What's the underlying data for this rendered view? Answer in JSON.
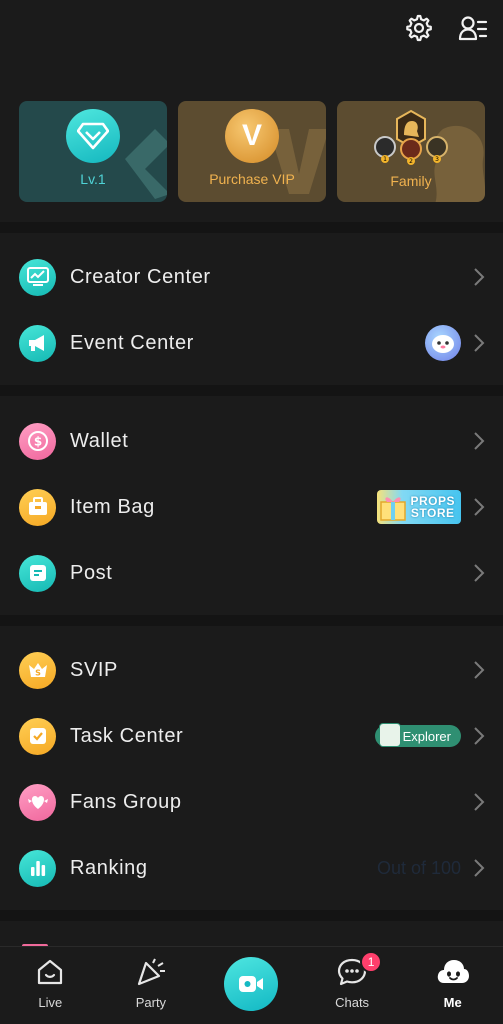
{
  "header": {
    "icons": [
      "gear-icon",
      "contacts-menu-icon"
    ]
  },
  "cards": [
    {
      "label": "Lv.1",
      "icon": "diamond-icon"
    },
    {
      "label": "Purchase VIP",
      "badge_letter": "V"
    },
    {
      "label": "Family",
      "icon": "family-crest-icon",
      "medals": [
        "1",
        "2",
        "3"
      ]
    }
  ],
  "sections": {
    "s1": [
      {
        "label": "Creator Center",
        "icon": "chart-board-icon"
      },
      {
        "label": "Event Center",
        "icon": "megaphone-icon",
        "extra": "event-avatar"
      }
    ],
    "s2": [
      {
        "label": "Wallet",
        "icon": "coin-icon"
      },
      {
        "label": "Item Bag",
        "icon": "bag-icon",
        "extra_lines": [
          "PROPS",
          "STORE"
        ]
      },
      {
        "label": "Post",
        "icon": "post-icon"
      }
    ],
    "s3": [
      {
        "label": "SVIP",
        "icon": "crown-coin-icon"
      },
      {
        "label": "Task Center",
        "icon": "task-icon",
        "tag": "Explorer"
      },
      {
        "label": "Fans Group",
        "icon": "heart-wings-icon"
      },
      {
        "label": "Ranking",
        "icon": "bar-chart-icon",
        "extra": "Out of 100"
      }
    ]
  },
  "bottom_nav": [
    {
      "label": "Live",
      "icon": "home-face-icon"
    },
    {
      "label": "Party",
      "icon": "party-popper-icon"
    },
    {
      "label": "",
      "icon": "video-camera-icon"
    },
    {
      "label": "Chats",
      "icon": "chat-bubble-icon",
      "badge": "1"
    },
    {
      "label": "Me",
      "icon": "cloud-face-icon",
      "active": true
    }
  ],
  "colors": {
    "background": "#1b1b1b",
    "accent_teal": "#1fc9c6",
    "gold": "#f0b24f",
    "badge_red": "#ff3f6c"
  }
}
